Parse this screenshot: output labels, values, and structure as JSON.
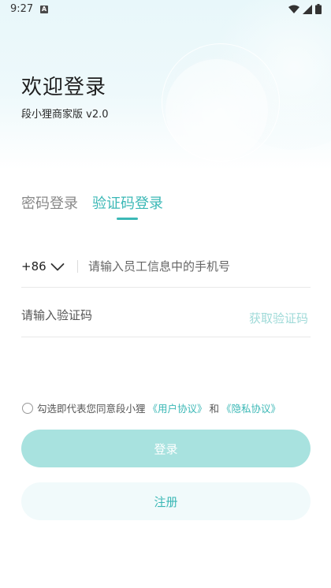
{
  "status_bar": {
    "time": "9:27",
    "notification_glyph": "A",
    "icons": [
      "wifi-icon",
      "signal-icon",
      "battery-icon"
    ]
  },
  "header": {
    "title": "欢迎登录",
    "subtitle": "段小狸商家版 v2.0"
  },
  "tabs": [
    {
      "label": "密码登录",
      "active": false
    },
    {
      "label": "验证码登录",
      "active": true
    }
  ],
  "phone": {
    "country_code": "+86",
    "placeholder": "请输入员工信息中的手机号",
    "value": ""
  },
  "verification": {
    "placeholder": "请输入验证码",
    "value": "",
    "get_code_label": "获取验证码"
  },
  "agreement": {
    "checked": false,
    "prefix": "勾选即代表您同意段小狸",
    "user_agreement": "《用户协议》",
    "conjunction": "和",
    "privacy_policy": "《隐私协议》"
  },
  "buttons": {
    "login_label": "登录",
    "register_label": "注册"
  },
  "colors": {
    "accent": "#3bb8b6",
    "login_button_bg": "#a8e2df",
    "register_button_bg": "#f1fafb",
    "get_code_disabled": "#9fdad8"
  }
}
